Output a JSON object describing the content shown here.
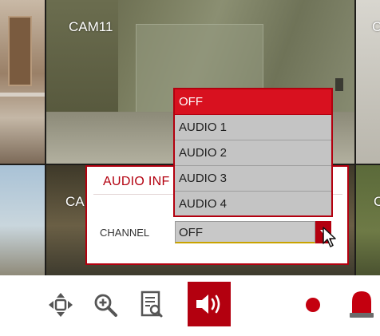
{
  "cameras": {
    "cam11_label": "CAM11",
    "bottom_left_label_partial": "CA",
    "top_right_label_partial": "C",
    "bottom_right_label_partial": "C"
  },
  "audio_dialog": {
    "title": "AUDIO INF",
    "channel_label": "CHANNEL",
    "channel_value": "OFF",
    "dropdown_options": [
      "OFF",
      "AUDIO 1",
      "AUDIO 2",
      "AUDIO 3",
      "AUDIO 4"
    ],
    "selected_index": 0
  },
  "toolbar": {
    "icons": [
      "move-icon",
      "zoom-in-icon",
      "search-log-icon",
      "speaker-icon",
      "record-icon",
      "alarm-icon"
    ]
  },
  "colors": {
    "accent": "#b3000f",
    "selected_option": "#d8111f",
    "dropdown_bg": "#c4c4c4"
  }
}
